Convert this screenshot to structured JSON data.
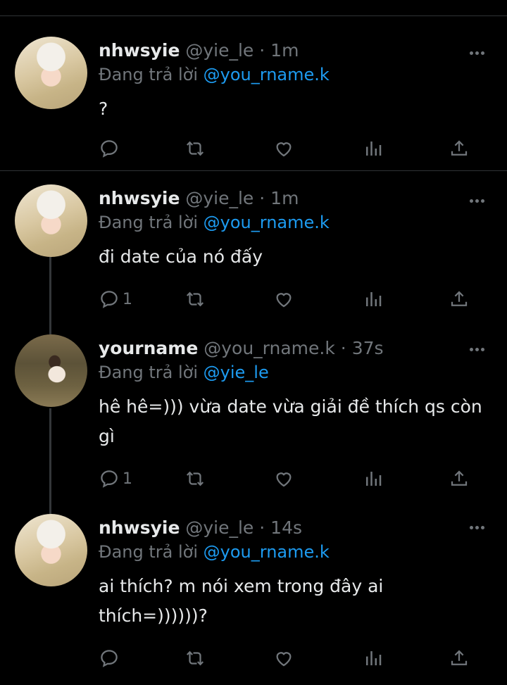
{
  "tweets": [
    {
      "name": "nhwsyie",
      "handle": "@yie_le",
      "dot": "·",
      "time": "1m",
      "reply_prefix": "Đang trả lời",
      "reply_to": "@you_rname.k",
      "text": "?",
      "reply_count": "",
      "avatar": "blonde-girl-avatar"
    },
    {
      "name": "nhwsyie",
      "handle": "@yie_le",
      "dot": "·",
      "time": "1m",
      "reply_prefix": "Đang trả lời",
      "reply_to": "@you_rname.k",
      "text": "đi date của nó đấy",
      "reply_count": "1",
      "avatar": "blonde-girl-avatar"
    },
    {
      "name": "yourname",
      "handle": "@you_rname.k",
      "dot": "·",
      "time": "37s",
      "reply_prefix": "Đang trả lời",
      "reply_to": "@yie_le",
      "text": "hê hê=))) vừa date vừa giải đề thích qs còn gì",
      "reply_count": "1",
      "avatar": "forest-girl-avatar"
    },
    {
      "name": "nhwsyie",
      "handle": "@yie_le",
      "dot": "·",
      "time": "14s",
      "reply_prefix": "Đang trả lời",
      "reply_to": "@you_rname.k",
      "text": "ai thích? m nói xem trong đây ai thích=))))))?",
      "reply_count": "",
      "avatar": "blonde-girl-avatar"
    }
  ],
  "icons": {
    "reply": "reply-icon",
    "retweet": "retweet-icon",
    "like": "heart-icon",
    "views": "stats-icon",
    "share": "share-icon",
    "more": "more-dots-icon"
  },
  "colors": {
    "background": "#000000",
    "text": "#e7e9ea",
    "muted": "#71767b",
    "mention": "#1d9bf0",
    "divider": "#2f3336"
  }
}
